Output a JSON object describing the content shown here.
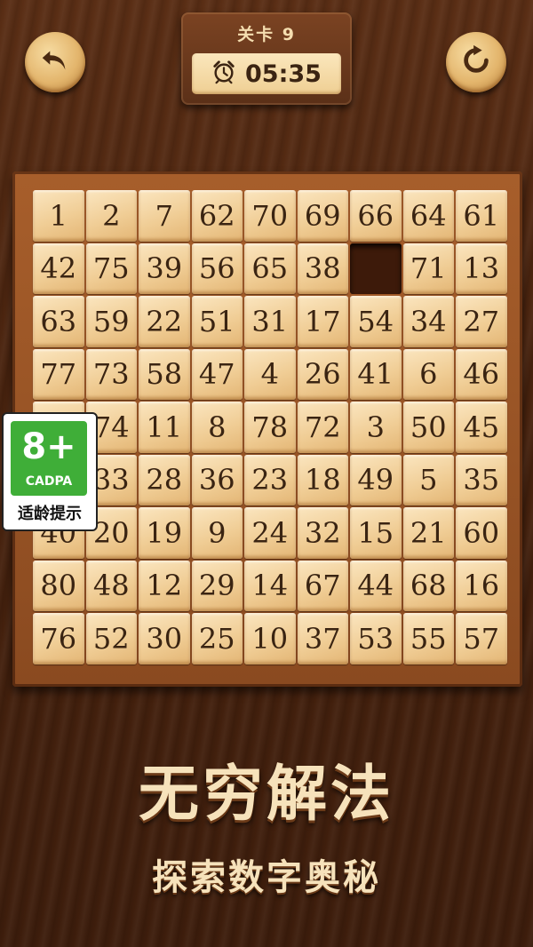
{
  "header": {
    "level_label": "关卡 9",
    "timer": "05:35",
    "back_icon": "undo-arrow-icon",
    "restart_icon": "restart-icon",
    "clock_icon": "alarm-clock-icon"
  },
  "board": {
    "columns": 9,
    "rows": 9,
    "tiles": [
      [
        "1",
        "2",
        "7",
        "62",
        "70",
        "69",
        "66",
        "64",
        "61"
      ],
      [
        "42",
        "75",
        "39",
        "56",
        "65",
        "38",
        "",
        "71",
        "13"
      ],
      [
        "63",
        "59",
        "22",
        "51",
        "31",
        "17",
        "54",
        "34",
        "27"
      ],
      [
        "77",
        "73",
        "58",
        "47",
        "4",
        "26",
        "41",
        "6",
        "46"
      ],
      [
        "",
        "74",
        "11",
        "8",
        "78",
        "72",
        "3",
        "50",
        "45"
      ],
      [
        "",
        "33",
        "28",
        "36",
        "23",
        "18",
        "49",
        "5",
        "35"
      ],
      [
        "40",
        "20",
        "19",
        "9",
        "24",
        "32",
        "15",
        "21",
        "60"
      ],
      [
        "80",
        "48",
        "12",
        "29",
        "14",
        "67",
        "44",
        "68",
        "16"
      ],
      [
        "76",
        "52",
        "30",
        "25",
        "10",
        "37",
        "53",
        "55",
        "57"
      ]
    ]
  },
  "slogan": "无穷解法",
  "sub_slogan": "探索数字奥秘",
  "age_rating": {
    "rating": "8+",
    "org": "CADPA",
    "tip": "适龄提示"
  },
  "colors": {
    "tile": "#f0cd95",
    "tile_text": "#3a2412",
    "board": "#a75e2b",
    "background": "#4a240f",
    "rating_green": "#3fae38"
  }
}
